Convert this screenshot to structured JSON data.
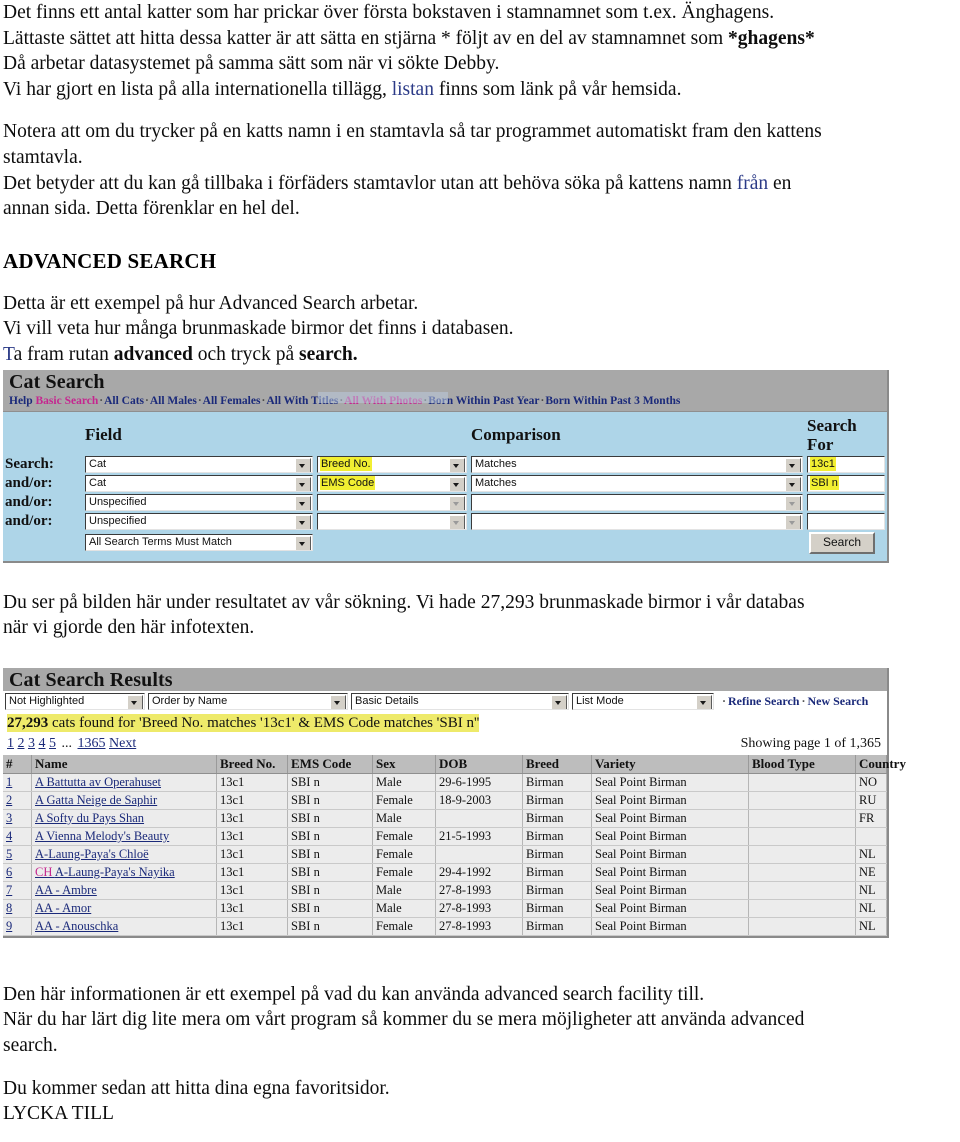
{
  "intro": {
    "line1": "Det finns ett antal katter som har prickar över första bokstaven i stamnamnet som t.ex. Änghagens.",
    "line2a": "Lättaste sättet att hitta dessa katter är att sätta en stjärna * följt av en del av stamnamnet som ",
    "line2b": "*ghagens*",
    "line3": "Då arbetar datasystemet på samma sätt som när vi sökte Debby.",
    "line4a": "Vi har gjort en lista på alla internationella tillägg, ",
    "line4_link": "listan",
    "line4b": " finns som länk på vår hemsida.",
    "para2a": "Notera att om du trycker på en katts namn i en stamtavla så tar programmet automatiskt fram den kattens",
    "para2b": "stamtavla.",
    "para3a": "Det betyder att du kan gå tillbaka i förfäders stamtavlor utan att behöva söka på kattens namn ",
    "para3_link": "från",
    "para3b": " en",
    "para3c": "annan sida. Detta förenklar en hel del."
  },
  "advanced": {
    "heading": "ADVANCED SEARCH",
    "line1": "Detta är ett exempel på hur Advanced Search arbetar.",
    "line2": "Vi vill veta hur många brunmaskade birmor det finns i databasen.",
    "line3_t": "T",
    "line3a": "a fram rutan ",
    "line3_b1": "advanced",
    "line3b": " och tryck på ",
    "line3_b2": "search."
  },
  "cat_search": {
    "title": "Cat Search",
    "nav": [
      {
        "label": "Help",
        "color": "blue"
      },
      {
        "label": "Basic Search",
        "color": "pink"
      },
      {
        "label": "All Cats",
        "color": "blue"
      },
      {
        "label": "All Males",
        "color": "blue"
      },
      {
        "label": "All Females",
        "color": "blue"
      },
      {
        "label": "All With Titles",
        "color": "blue"
      },
      {
        "label": "All With Photos",
        "color": "pink"
      },
      {
        "label": "Born Within Past Year",
        "color": "blue"
      },
      {
        "label": "Born Within Past 3 Months",
        "color": "blue"
      }
    ],
    "headers": {
      "field": "Field",
      "comparison": "Comparison",
      "search_for": "Search For"
    },
    "rows": [
      {
        "label": "Search:",
        "field": "Cat",
        "subfield": "Breed No.",
        "subfield_highlighted": true,
        "comparison": "Matches",
        "value": "13c1",
        "value_highlighted": true,
        "enabled": true
      },
      {
        "label": "and/or:",
        "field": "Cat",
        "subfield": "EMS Code",
        "subfield_highlighted": true,
        "comparison": "Matches",
        "value": "SBI n",
        "value_highlighted": true,
        "enabled": true
      },
      {
        "label": "and/or:",
        "field": "Unspecified",
        "subfield": "",
        "subfield_highlighted": false,
        "comparison": "",
        "value": "",
        "value_highlighted": false,
        "enabled": false
      },
      {
        "label": "and/or:",
        "field": "Unspecified",
        "subfield": "",
        "subfield_highlighted": false,
        "comparison": "",
        "value": "",
        "value_highlighted": false,
        "enabled": false
      }
    ],
    "match_mode": "All Search Terms Must Match",
    "search_button": "Search"
  },
  "middle_text": {
    "line1": "Du ser på bilden här under resultatet av vår sökning. Vi hade 27,293 brunmaskade birmor i vår databas",
    "line2": "när vi gjorde den här infotexten."
  },
  "results": {
    "title": "Cat Search Results",
    "toolbar": {
      "highlight": "Not Highlighted",
      "order": "Order by Name",
      "detail": "Basic Details",
      "mode": "List Mode",
      "refine_search": "Refine Search",
      "new_search": "New Search"
    },
    "found_count": "27,293",
    "found_text": " cats found for 'Breed No. matches '13c1' & EMS Code matches 'SBI n''",
    "pages": [
      "1",
      "2",
      "3",
      "4",
      "5"
    ],
    "page_dots": "...",
    "last_page": "1365",
    "next": "Next",
    "showing": "Showing page 1 of 1,365",
    "columns": [
      "#",
      "Name",
      "Breed No.",
      "EMS Code",
      "Sex",
      "DOB",
      "Breed",
      "Variety",
      "Blood Type",
      "Country"
    ],
    "rows": [
      {
        "num": "1",
        "prefix": "",
        "name": "A Battutta av Operahuset",
        "breed_no": "13c1",
        "ems": "SBI n",
        "sex": "Male",
        "dob": "29-6-1995",
        "breed": "Birman",
        "variety": "Seal Point Birman",
        "blood": "",
        "country": "NO"
      },
      {
        "num": "2",
        "prefix": "",
        "name": "A Gatta Neige de Saphir",
        "breed_no": "13c1",
        "ems": "SBI n",
        "sex": "Female",
        "dob": "18-9-2003",
        "breed": "Birman",
        "variety": "Seal Point Birman",
        "blood": "",
        "country": "RU"
      },
      {
        "num": "3",
        "prefix": "",
        "name": "A Softy du Pays Shan",
        "breed_no": "13c1",
        "ems": "SBI n",
        "sex": "Male",
        "dob": "",
        "breed": "Birman",
        "variety": "Seal Point Birman",
        "blood": "",
        "country": "FR"
      },
      {
        "num": "4",
        "prefix": "",
        "name": "A Vienna Melody's Beauty",
        "breed_no": "13c1",
        "ems": "SBI n",
        "sex": "Female",
        "dob": "21-5-1993",
        "breed": "Birman",
        "variety": "Seal Point Birman",
        "blood": "",
        "country": ""
      },
      {
        "num": "5",
        "prefix": "",
        "name": "A-Laung-Paya's Chloë",
        "breed_no": "13c1",
        "ems": "SBI n",
        "sex": "Female",
        "dob": "",
        "breed": "Birman",
        "variety": "Seal Point Birman",
        "blood": "",
        "country": "NL"
      },
      {
        "num": "6",
        "prefix": "CH",
        "name": "A-Laung-Paya's Nayika",
        "breed_no": "13c1",
        "ems": "SBI n",
        "sex": "Female",
        "dob": "29-4-1992",
        "breed": "Birman",
        "variety": "Seal Point Birman",
        "blood": "",
        "country": "NE"
      },
      {
        "num": "7",
        "prefix": "",
        "name": "AA - Ambre",
        "breed_no": "13c1",
        "ems": "SBI n",
        "sex": "Male",
        "dob": "27-8-1993",
        "breed": "Birman",
        "variety": "Seal Point Birman",
        "blood": "",
        "country": "NL"
      },
      {
        "num": "8",
        "prefix": "",
        "name": "AA - Amor",
        "breed_no": "13c1",
        "ems": "SBI n",
        "sex": "Male",
        "dob": "27-8-1993",
        "breed": "Birman",
        "variety": "Seal Point Birman",
        "blood": "",
        "country": "NL"
      },
      {
        "num": "9",
        "prefix": "",
        "name": "AA - Anouschka",
        "breed_no": "13c1",
        "ems": "SBI n",
        "sex": "Female",
        "dob": "27-8-1993",
        "breed": "Birman",
        "variety": "Seal Point Birman",
        "blood": "",
        "country": "NL"
      }
    ]
  },
  "outro": {
    "line1": "Den här informationen är ett exempel på vad du kan använda advanced search facility till.",
    "line2a": "När du har lärt dig lite mera om vårt program så kommer du se mera möjligheter att använda advanced",
    "line2b": "search.",
    "line3": "Du kommer sedan att hitta dina egna favoritsidor.",
    "line4": "LYCKA TILL"
  }
}
